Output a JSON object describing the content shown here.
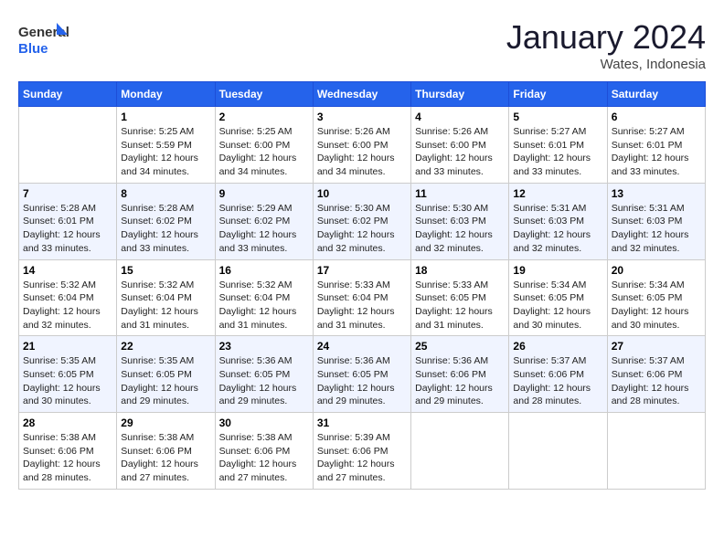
{
  "header": {
    "logo_general": "General",
    "logo_blue": "Blue",
    "month_title": "January 2024",
    "location": "Wates, Indonesia"
  },
  "days_of_week": [
    "Sunday",
    "Monday",
    "Tuesday",
    "Wednesday",
    "Thursday",
    "Friday",
    "Saturday"
  ],
  "weeks": [
    [
      {
        "day": "",
        "info": ""
      },
      {
        "day": "1",
        "info": "Sunrise: 5:25 AM\nSunset: 5:59 PM\nDaylight: 12 hours\nand 34 minutes."
      },
      {
        "day": "2",
        "info": "Sunrise: 5:25 AM\nSunset: 6:00 PM\nDaylight: 12 hours\nand 34 minutes."
      },
      {
        "day": "3",
        "info": "Sunrise: 5:26 AM\nSunset: 6:00 PM\nDaylight: 12 hours\nand 34 minutes."
      },
      {
        "day": "4",
        "info": "Sunrise: 5:26 AM\nSunset: 6:00 PM\nDaylight: 12 hours\nand 33 minutes."
      },
      {
        "day": "5",
        "info": "Sunrise: 5:27 AM\nSunset: 6:01 PM\nDaylight: 12 hours\nand 33 minutes."
      },
      {
        "day": "6",
        "info": "Sunrise: 5:27 AM\nSunset: 6:01 PM\nDaylight: 12 hours\nand 33 minutes."
      }
    ],
    [
      {
        "day": "7",
        "info": "Sunrise: 5:28 AM\nSunset: 6:01 PM\nDaylight: 12 hours\nand 33 minutes."
      },
      {
        "day": "8",
        "info": "Sunrise: 5:28 AM\nSunset: 6:02 PM\nDaylight: 12 hours\nand 33 minutes."
      },
      {
        "day": "9",
        "info": "Sunrise: 5:29 AM\nSunset: 6:02 PM\nDaylight: 12 hours\nand 33 minutes."
      },
      {
        "day": "10",
        "info": "Sunrise: 5:30 AM\nSunset: 6:02 PM\nDaylight: 12 hours\nand 32 minutes."
      },
      {
        "day": "11",
        "info": "Sunrise: 5:30 AM\nSunset: 6:03 PM\nDaylight: 12 hours\nand 32 minutes."
      },
      {
        "day": "12",
        "info": "Sunrise: 5:31 AM\nSunset: 6:03 PM\nDaylight: 12 hours\nand 32 minutes."
      },
      {
        "day": "13",
        "info": "Sunrise: 5:31 AM\nSunset: 6:03 PM\nDaylight: 12 hours\nand 32 minutes."
      }
    ],
    [
      {
        "day": "14",
        "info": "Sunrise: 5:32 AM\nSunset: 6:04 PM\nDaylight: 12 hours\nand 32 minutes."
      },
      {
        "day": "15",
        "info": "Sunrise: 5:32 AM\nSunset: 6:04 PM\nDaylight: 12 hours\nand 31 minutes."
      },
      {
        "day": "16",
        "info": "Sunrise: 5:32 AM\nSunset: 6:04 PM\nDaylight: 12 hours\nand 31 minutes."
      },
      {
        "day": "17",
        "info": "Sunrise: 5:33 AM\nSunset: 6:04 PM\nDaylight: 12 hours\nand 31 minutes."
      },
      {
        "day": "18",
        "info": "Sunrise: 5:33 AM\nSunset: 6:05 PM\nDaylight: 12 hours\nand 31 minutes."
      },
      {
        "day": "19",
        "info": "Sunrise: 5:34 AM\nSunset: 6:05 PM\nDaylight: 12 hours\nand 30 minutes."
      },
      {
        "day": "20",
        "info": "Sunrise: 5:34 AM\nSunset: 6:05 PM\nDaylight: 12 hours\nand 30 minutes."
      }
    ],
    [
      {
        "day": "21",
        "info": "Sunrise: 5:35 AM\nSunset: 6:05 PM\nDaylight: 12 hours\nand 30 minutes."
      },
      {
        "day": "22",
        "info": "Sunrise: 5:35 AM\nSunset: 6:05 PM\nDaylight: 12 hours\nand 29 minutes."
      },
      {
        "day": "23",
        "info": "Sunrise: 5:36 AM\nSunset: 6:05 PM\nDaylight: 12 hours\nand 29 minutes."
      },
      {
        "day": "24",
        "info": "Sunrise: 5:36 AM\nSunset: 6:05 PM\nDaylight: 12 hours\nand 29 minutes."
      },
      {
        "day": "25",
        "info": "Sunrise: 5:36 AM\nSunset: 6:06 PM\nDaylight: 12 hours\nand 29 minutes."
      },
      {
        "day": "26",
        "info": "Sunrise: 5:37 AM\nSunset: 6:06 PM\nDaylight: 12 hours\nand 28 minutes."
      },
      {
        "day": "27",
        "info": "Sunrise: 5:37 AM\nSunset: 6:06 PM\nDaylight: 12 hours\nand 28 minutes."
      }
    ],
    [
      {
        "day": "28",
        "info": "Sunrise: 5:38 AM\nSunset: 6:06 PM\nDaylight: 12 hours\nand 28 minutes."
      },
      {
        "day": "29",
        "info": "Sunrise: 5:38 AM\nSunset: 6:06 PM\nDaylight: 12 hours\nand 27 minutes."
      },
      {
        "day": "30",
        "info": "Sunrise: 5:38 AM\nSunset: 6:06 PM\nDaylight: 12 hours\nand 27 minutes."
      },
      {
        "day": "31",
        "info": "Sunrise: 5:39 AM\nSunset: 6:06 PM\nDaylight: 12 hours\nand 27 minutes."
      },
      {
        "day": "",
        "info": ""
      },
      {
        "day": "",
        "info": ""
      },
      {
        "day": "",
        "info": ""
      }
    ]
  ]
}
